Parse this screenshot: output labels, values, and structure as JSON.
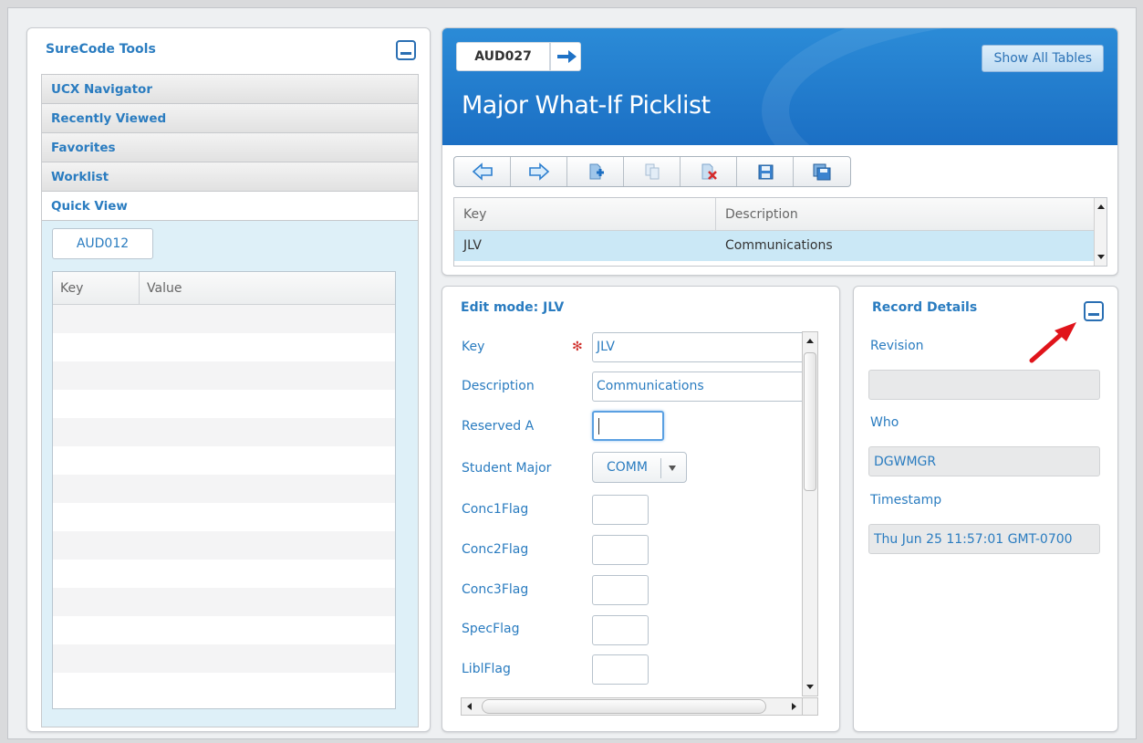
{
  "sidebar": {
    "title": "SureCode Tools",
    "sections": [
      {
        "label": "UCX Navigator"
      },
      {
        "label": "Recently Viewed"
      },
      {
        "label": "Favorites"
      },
      {
        "label": "Worklist"
      },
      {
        "label": "Quick View"
      }
    ],
    "quick_view": {
      "tab_label": "AUD012",
      "columns": [
        "Key",
        "Value"
      ]
    }
  },
  "header": {
    "code": "AUD027",
    "title": "Major What-If Picklist",
    "show_all_label": "Show All Tables"
  },
  "toolbar": {
    "buttons": [
      "back-arrow-icon",
      "forward-arrow-icon",
      "add-record-icon",
      "copy-record-icon",
      "delete-record-icon",
      "save-icon",
      "save-all-icon"
    ]
  },
  "list": {
    "columns": [
      "Key",
      "Description"
    ],
    "rows": [
      {
        "key": "JLV",
        "description": "Communications"
      }
    ]
  },
  "edit": {
    "title": "Edit mode: JLV",
    "fields": {
      "key_label": "Key",
      "key_value": "JLV",
      "description_label": "Description",
      "description_value": "Communications",
      "reserved_a_label": "Reserved A",
      "student_major_label": "Student Major",
      "student_major_value": "COMM",
      "conc1_label": "Conc1Flag",
      "conc2_label": "Conc2Flag",
      "conc3_label": "Conc3Flag",
      "spec_label": "SpecFlag",
      "libl_label": "LiblFlag"
    }
  },
  "details": {
    "title": "Record Details",
    "revision_label": "Revision",
    "revision_value": "",
    "who_label": "Who",
    "who_value": "DGWMGR",
    "timestamp_label": "Timestamp",
    "timestamp_value": "Thu Jun 25 11:57:01 GMT-0700"
  },
  "colors": {
    "accent": "#2a7cc0",
    "banner": "#1b6fc4",
    "selected_row": "#cbe8f6",
    "annotation": "#e0141b"
  }
}
